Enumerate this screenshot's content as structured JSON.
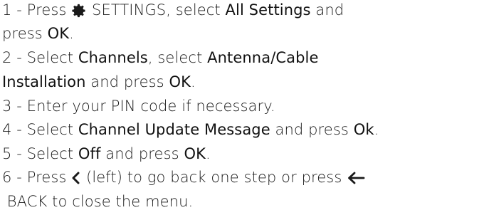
{
  "steps": [
    {
      "id": "step1",
      "lines": [
        {
          "num": "1 - ",
          "parts": [
            "Press ",
            "__gear__",
            " SETTINGS, select ",
            {
              "b": "All Settings"
            },
            " and"
          ]
        },
        {
          "parts": [
            "press ",
            {
              "b": "OK"
            },
            "."
          ]
        }
      ]
    },
    {
      "id": "step2",
      "lines": [
        {
          "num": "2 - ",
          "parts": [
            "Select ",
            {
              "b": "Channels"
            },
            ", select ",
            {
              "b": "Antenna/Cable"
            }
          ]
        },
        {
          "parts": [
            {
              "b": "Installation"
            },
            " and press ",
            {
              "b": "OK"
            },
            "."
          ]
        }
      ]
    },
    {
      "id": "step3",
      "lines": [
        {
          "num": "3 - ",
          "parts": [
            "Enter your PIN code if necessary."
          ]
        }
      ]
    },
    {
      "id": "step4",
      "lines": [
        {
          "num": "4 - ",
          "parts": [
            "Select ",
            {
              "b": "Channel Update Message"
            },
            " and press ",
            {
              "b": "Ok"
            },
            "."
          ]
        }
      ]
    },
    {
      "id": "step5",
      "lines": [
        {
          "num": "5 - ",
          "parts": [
            "Select ",
            {
              "b": "Off"
            },
            " and press ",
            {
              "b": "OK"
            },
            "."
          ]
        }
      ]
    },
    {
      "id": "step6",
      "lines": [
        {
          "num": "6 - ",
          "parts": [
            "Press ",
            "__chevron__",
            " (left) to go back one step or press ",
            "__arrow__"
          ]
        },
        {
          "parts": [
            " BACK to close the menu."
          ]
        }
      ]
    }
  ],
  "icons": {
    "gear": "settings-gear-icon",
    "chevron": "chevron-left-icon",
    "arrow": "back-arrow-icon"
  },
  "colors": {
    "text": "#1a1a1a"
  }
}
